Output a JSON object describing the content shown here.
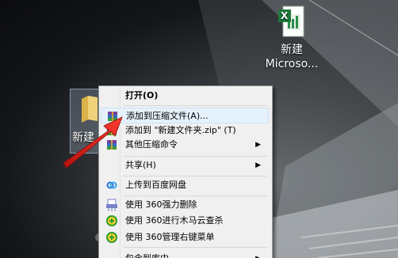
{
  "desktop": {
    "excel_icon": {
      "icon": "excel-file-icon",
      "label_line1": "新建",
      "label_line2": "Microso..."
    },
    "folder_icon": {
      "icon": "folder-icon",
      "label": "新建"
    }
  },
  "context_menu": {
    "items": [
      {
        "label": "打开(O)",
        "icon": "",
        "submenu": false
      },
      {
        "label": "添加到压缩文件(A)...",
        "icon": "winrar-icon",
        "submenu": false
      },
      {
        "label": "添加到 \"新建文件夹.zip\" (T)",
        "icon": "winrar-icon",
        "submenu": false
      },
      {
        "label": "其他压缩命令",
        "icon": "winrar-icon",
        "submenu": true
      },
      {
        "label": "共享(H)",
        "icon": "",
        "submenu": true
      },
      {
        "label": "上传到百度网盘",
        "icon": "baidu-cloud-icon",
        "submenu": false
      },
      {
        "label": "使用 360强力删除",
        "icon": "360-shredder-icon",
        "submenu": false
      },
      {
        "label": "使用 360进行木马云查杀",
        "icon": "360-antivirus-icon",
        "submenu": false
      },
      {
        "label": "使用 360管理右键菜单",
        "icon": "360-menu-manager-icon",
        "submenu": false
      },
      {
        "label": "包含到库中",
        "icon": "",
        "submenu": true
      }
    ]
  },
  "colors": {
    "highlight": "#e5f1fb",
    "arrow": "#e0261d",
    "menu_bg": "#f0f0f0"
  }
}
